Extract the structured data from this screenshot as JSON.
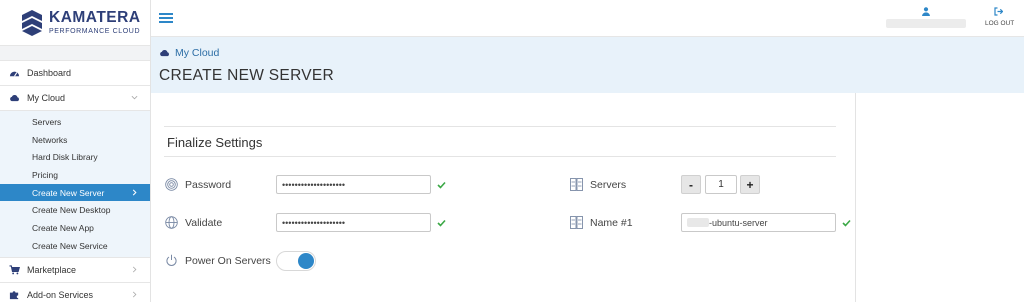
{
  "brand": {
    "name": "KAMATERA",
    "tagline": "PERFORMANCE CLOUD",
    "color": "#2e3f78"
  },
  "colors": {
    "accent": "#2d87c8",
    "header_bg": "#e8f2fa",
    "active_nav": "#2d87c8",
    "check": "#3aa845"
  },
  "sidebar": {
    "items": [
      {
        "label": "Dashboard",
        "icon": "dashboard-icon"
      },
      {
        "label": "My Cloud",
        "icon": "cloud-icon",
        "expanded": true,
        "children": [
          {
            "label": "Servers"
          },
          {
            "label": "Networks"
          },
          {
            "label": "Hard Disk Library"
          },
          {
            "label": "Pricing"
          },
          {
            "label": "Create New Server",
            "active": true
          },
          {
            "label": "Create New Desktop"
          },
          {
            "label": "Create New App"
          },
          {
            "label": "Create New Service"
          }
        ]
      },
      {
        "label": "Marketplace",
        "icon": "cart-icon"
      },
      {
        "label": "Add-on Services",
        "icon": "puzzle-icon"
      }
    ]
  },
  "topbar": {
    "menu_icon": "hamburger-icon",
    "user_icon": "user-icon",
    "logout_icon": "logout-icon",
    "logout_label": "LOG OUT"
  },
  "header": {
    "breadcrumb": "My Cloud",
    "title": "CREATE NEW SERVER"
  },
  "main": {
    "section_title": "Finalize Settings",
    "password": {
      "label": "Password",
      "value": "••••••••••••••••••••",
      "valid": true
    },
    "validate": {
      "label": "Validate",
      "value": "••••••••••••••••••••",
      "valid": true
    },
    "power_on": {
      "label": "Power On Servers",
      "enabled": true
    },
    "servers": {
      "label": "Servers",
      "value": "1",
      "minus": "-",
      "plus": "+"
    },
    "name": {
      "label": "Name #1",
      "value": "-ubuntu-server",
      "valid": true
    }
  }
}
